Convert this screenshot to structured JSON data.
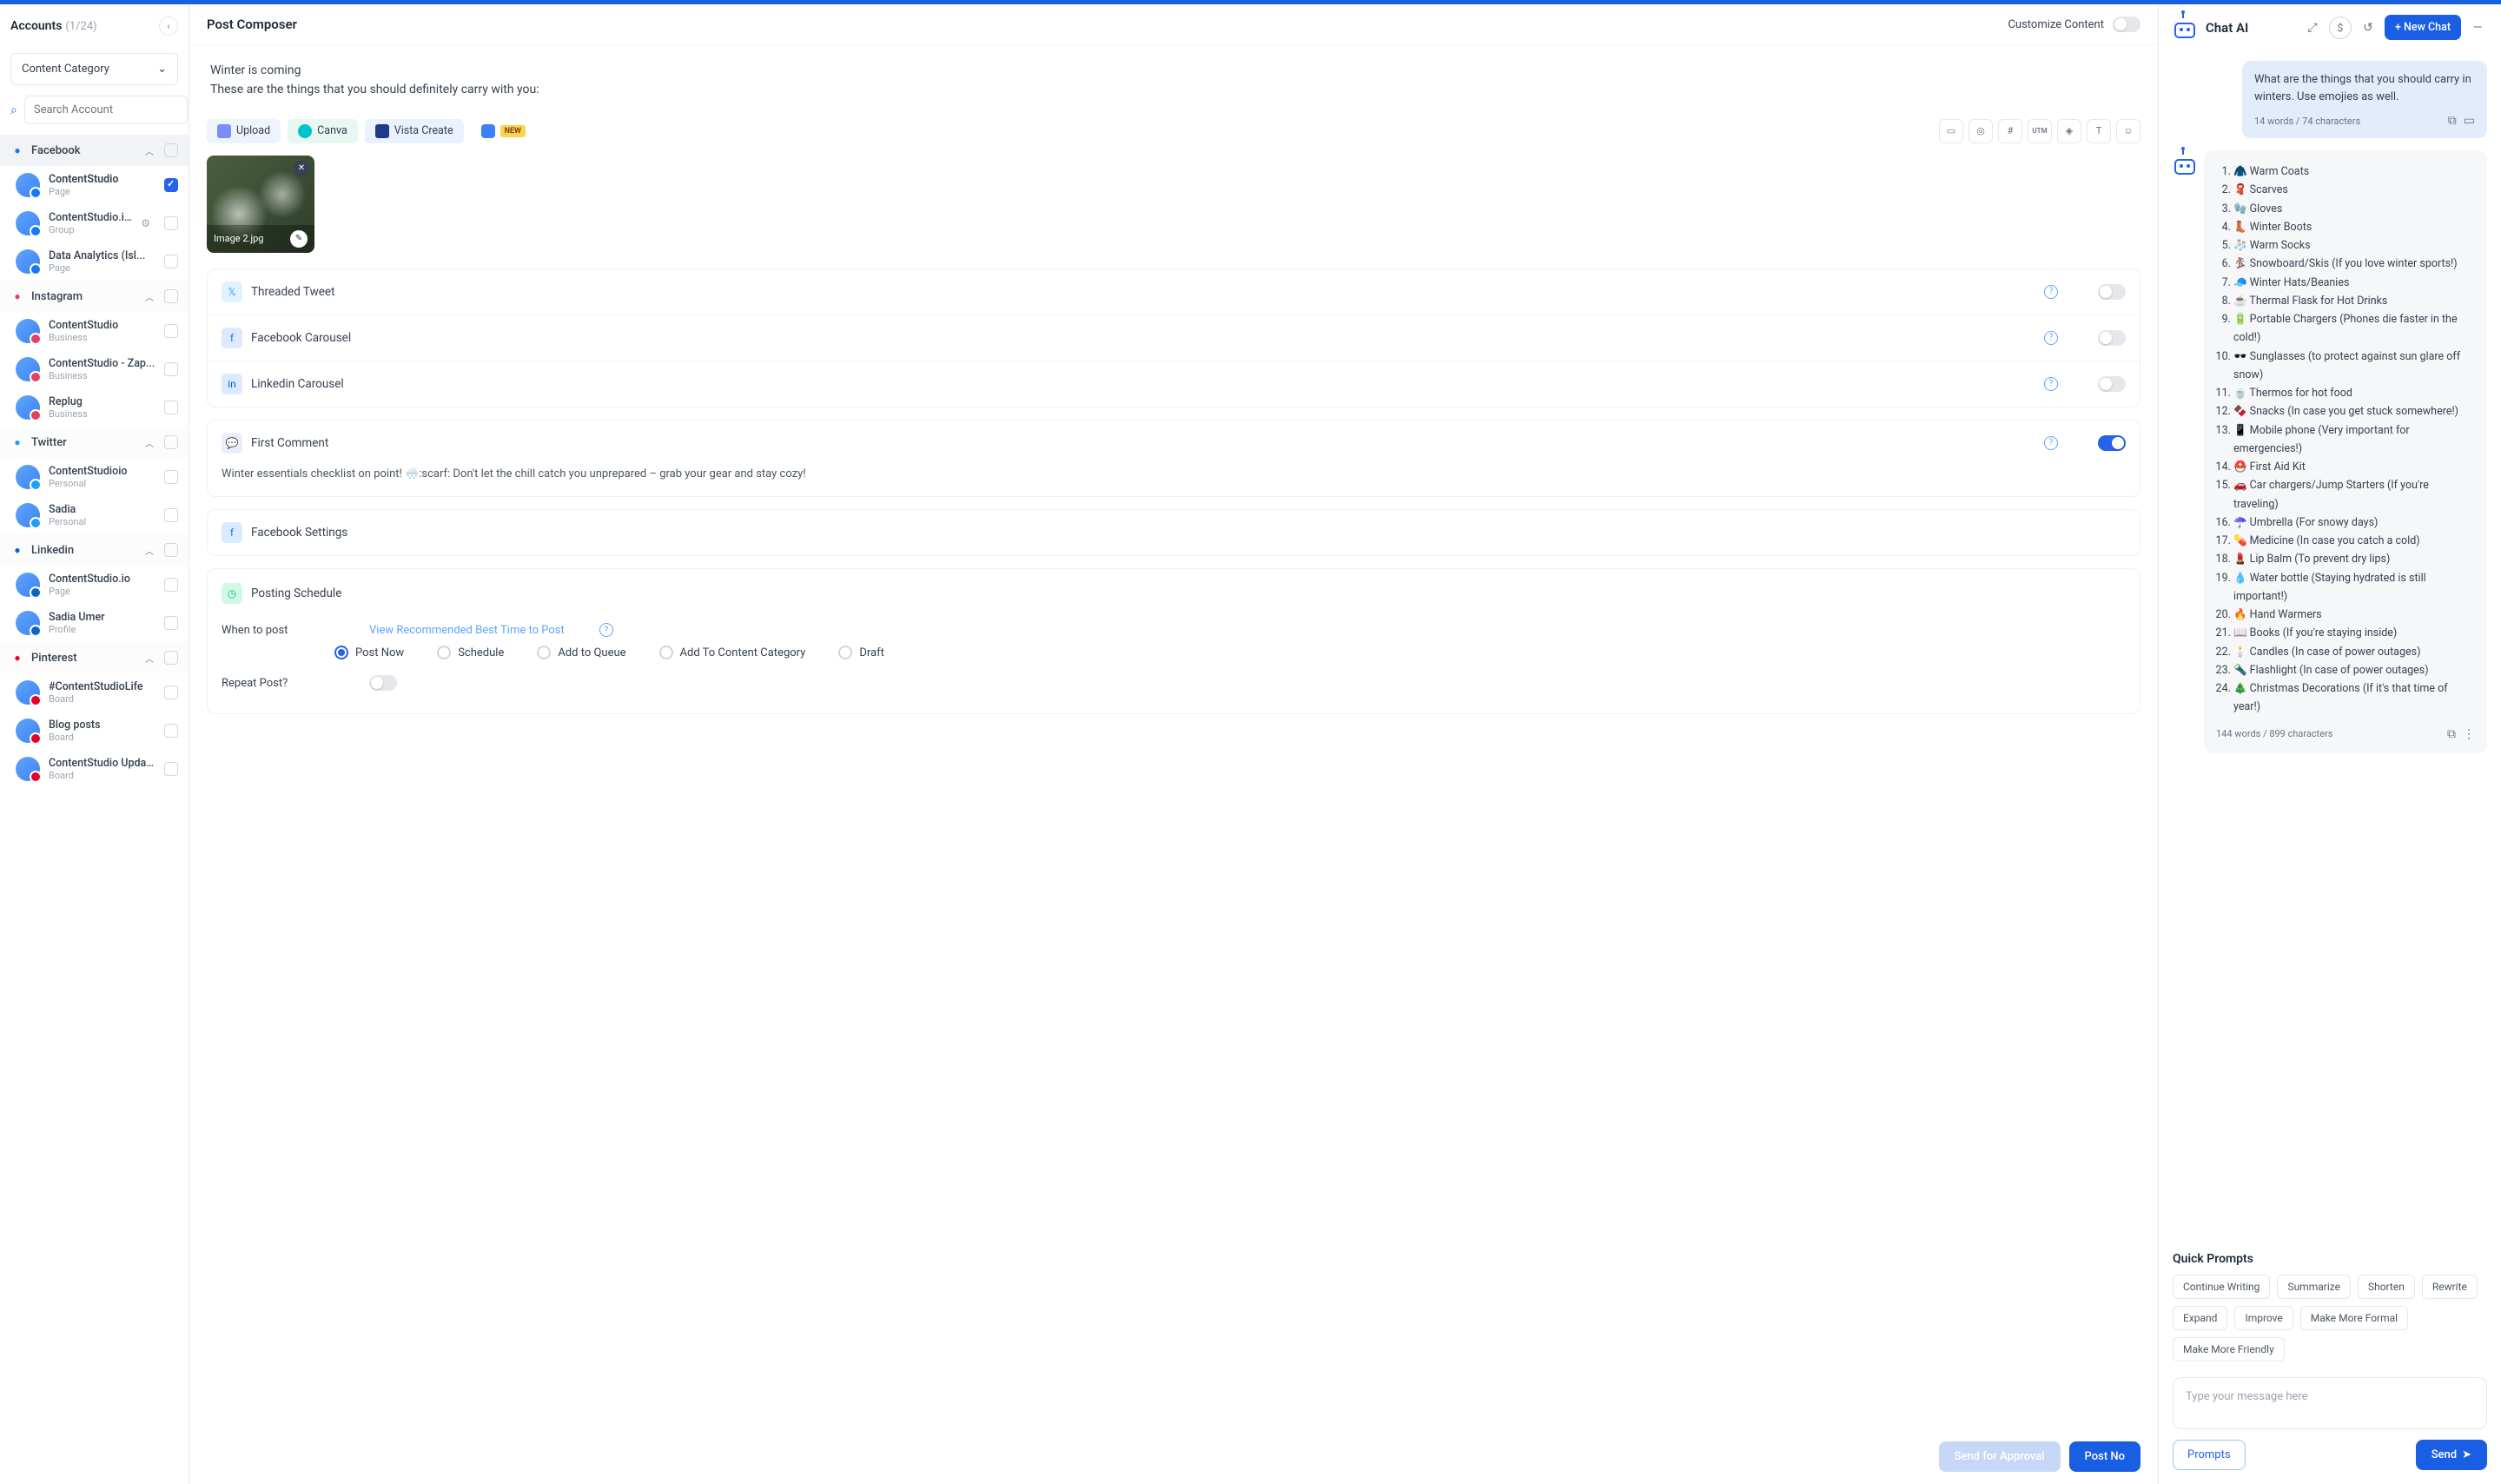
{
  "sidebar": {
    "title": "Accounts",
    "count": "(1/24)",
    "category_label": "Content Category",
    "search_placeholder": "Search Account",
    "networks": [
      {
        "name": "Facebook",
        "color": "#1877f2",
        "accounts": [
          {
            "name": "ContentStudio",
            "type": "Page",
            "checked": true,
            "bold": true
          },
          {
            "name": "ContentStudio.io Co...",
            "type": "Group",
            "gear": true
          },
          {
            "name": "Data Analytics (Isl...",
            "type": "Page"
          }
        ]
      },
      {
        "name": "Instagram",
        "color": "#e4405f",
        "accounts": [
          {
            "name": "ContentStudio",
            "type": "Business"
          },
          {
            "name": "ContentStudio - Zap...",
            "type": "Business"
          },
          {
            "name": "Replug",
            "type": "Business"
          }
        ]
      },
      {
        "name": "Twitter",
        "color": "#1da1f2",
        "accounts": [
          {
            "name": "ContentStudioio",
            "type": "Personal"
          },
          {
            "name": "Sadia",
            "type": "Personal"
          }
        ]
      },
      {
        "name": "Linkedin",
        "color": "#0a66c2",
        "accounts": [
          {
            "name": "ContentStudio.io",
            "type": "Page"
          },
          {
            "name": "Sadia Umer",
            "type": "Profile"
          }
        ]
      },
      {
        "name": "Pinterest",
        "color": "#e60023",
        "accounts": [
          {
            "name": "#ContentStudioLife",
            "type": "Board"
          },
          {
            "name": "Blog posts",
            "type": "Board"
          },
          {
            "name": "ContentStudio Updat...",
            "type": "Board"
          }
        ]
      }
    ]
  },
  "composer": {
    "title": "Post Composer",
    "customize": "Customize Content",
    "text_line1": "Winter is coming",
    "text_line2": "These are the things that you should definitely carry with you:",
    "tools": {
      "upload": "Upload",
      "canva": "Canva",
      "vista": "Vista Create",
      "new": "NEW"
    },
    "icon_btns": {
      "utm": "UTM"
    },
    "image": {
      "name": "Image 2.jpg"
    },
    "threaded": "Threaded Tweet",
    "fb_carousel": "Facebook Carousel",
    "li_carousel": "Linkedin Carousel",
    "first_comment": "First Comment",
    "first_comment_text": "Winter essentials checklist on point! 🌨️:scarf: Don't let the chill catch you unprepared – grab your gear and stay cozy!",
    "fb_settings": "Facebook Settings",
    "schedule": {
      "title": "Posting Schedule",
      "when": "When to post",
      "rec": "View Recommended Best Time to Post",
      "options": [
        "Post Now",
        "Schedule",
        "Add to Queue",
        "Add To Content Category",
        "Draft"
      ],
      "repeat": "Repeat Post?"
    },
    "actions": {
      "approval": "Send for Approval",
      "post": "Post No"
    }
  },
  "chat": {
    "title": "Chat AI",
    "new_chat": "+ New Chat",
    "user_msg": "What are the things that you should carry in winters. Use emojies as well.",
    "user_meta": "14 words / 74 characters",
    "ai_items": [
      "🧥 Warm Coats",
      "🧣 Scarves",
      "🧤 Gloves",
      "👢 Winter Boots",
      "🧦 Warm Socks",
      "🏂 Snowboard/Skis (If you love winter sports!)",
      "🧢 Winter Hats/Beanies",
      "☕ Thermal Flask for Hot Drinks",
      "🔋 Portable Chargers (Phones die faster in the cold!)",
      "🕶️ Sunglasses (to protect against sun glare off snow)",
      "🍵 Thermos for hot food",
      "🍫 Snacks (In case you get stuck somewhere!)",
      "📱 Mobile phone (Very important for emergencies!)",
      "⛑️ First Aid Kit",
      "🚗 Car chargers/Jump Starters (If you're traveling)",
      "☂️ Umbrella (For snowy days)",
      "💊 Medicine (In case you catch a cold)",
      "💄 Lip Balm (To prevent dry lips)",
      "💧 Water bottle (Staying hydrated is still important!)",
      "🔥 Hand Warmers",
      "📖 Books (If you're staying inside)",
      "🕯️ Candles (In case of power outages)",
      "🔦 Flashlight (In case of power outages)",
      "🎄 Christmas Decorations (If it's that time of year!)"
    ],
    "ai_meta": "144 words / 899 characters",
    "quick_title": "Quick Prompts",
    "quick": [
      "Continue Writing",
      "Summarize",
      "Shorten",
      "Rewrite",
      "Expand",
      "Improve",
      "Make More Formal",
      "Make More Friendly"
    ],
    "input_placeholder": "Type your message here",
    "prompts_btn": "Prompts",
    "send_btn": "Send"
  }
}
